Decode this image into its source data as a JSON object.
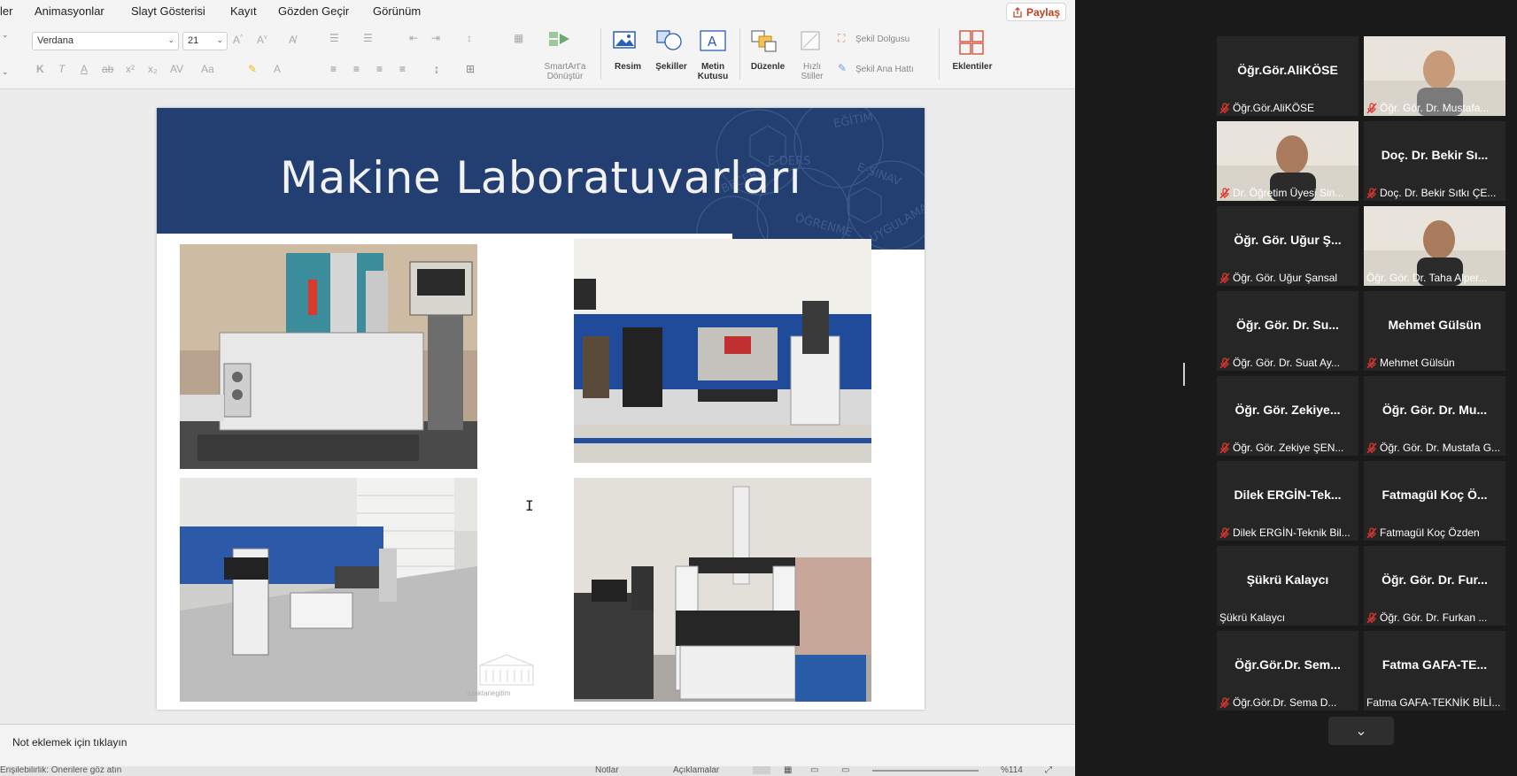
{
  "menu": {
    "items": [
      "ler",
      "Animasyonlar",
      "Slayt Gösterisi",
      "Kayıt",
      "Gözden Geçir",
      "Görünüm"
    ],
    "share_label": "Paylaş"
  },
  "ribbon": {
    "font_name": "Verdana",
    "font_size": "21",
    "smartart_label": "SmartArt'a\nDönüştür",
    "picture_label": "Resim",
    "shapes_label": "Şekiller",
    "textbox_label": "Metin\nKutusu",
    "arrange_label": "Düzenle",
    "quickstyles_label": "Hızlı\nStiller",
    "shape_fill_label": "Şekil Dolgusu",
    "shape_outline_label": "Şekil Ana Hattı",
    "addins_label": "Eklentiler"
  },
  "slide": {
    "title": "Makine Laboratuvarları",
    "banner_words": [
      "E-DERS",
      "EĞİTİM",
      "E-SINAV",
      "BECERİ",
      "ÖĞRENME",
      "UYGULAMA"
    ],
    "watermark_text": "uzaktanegitim"
  },
  "notes": {
    "placeholder": "Not eklemek için tıklayın"
  },
  "status": {
    "left": "Erişilebilirlik: Önerilere göz atın",
    "notes_label": "Notlar",
    "comments_label": "Açıklamalar",
    "zoom": "%114"
  },
  "participants": [
    {
      "big": "Öğr.Gör.AliKÖSE",
      "name": "Öğr.Gör.AliKÖSE",
      "muted": true,
      "video": false
    },
    {
      "big": "",
      "name": "Öğr. Gör. Dr. Mustafa...",
      "muted": true,
      "video": true
    },
    {
      "big": "",
      "name": "Dr. Öğretim Üyesi Sin...",
      "muted": true,
      "video": true
    },
    {
      "big": "Doç. Dr. Bekir Sı...",
      "name": "Doç. Dr. Bekir Sıtkı ÇE...",
      "muted": true,
      "video": false
    },
    {
      "big": "Öğr. Gör. Uğur Ş...",
      "name": "Öğr. Gör. Uğur Şansal",
      "muted": true,
      "video": false
    },
    {
      "big": "",
      "name": "Öğr. Gör. Dr. Taha Alper...",
      "muted": false,
      "video": true,
      "active": true
    },
    {
      "big": "Öğr. Gör. Dr. Su...",
      "name": "Öğr. Gör. Dr. Suat Ay...",
      "muted": true,
      "video": false
    },
    {
      "big": "Mehmet Gülsün",
      "name": "Mehmet Gülsün",
      "muted": true,
      "video": false
    },
    {
      "big": "Öğr. Gör. Zekiye...",
      "name": "Öğr. Gör. Zekiye ŞEN...",
      "muted": true,
      "video": false
    },
    {
      "big": "Öğr. Gör. Dr. Mu...",
      "name": "Öğr. Gör. Dr. Mustafa G...",
      "muted": true,
      "video": false
    },
    {
      "big": "Dilek ERGİN-Tek...",
      "name": "Dilek ERGİN-Teknik Bil...",
      "muted": true,
      "video": false
    },
    {
      "big": "Fatmagül Koç Ö...",
      "name": "Fatmagül Koç Özden",
      "muted": true,
      "video": false
    },
    {
      "big": "Şükrü Kalaycı",
      "name": "Şükrü Kalaycı",
      "muted": false,
      "video": false
    },
    {
      "big": "Öğr. Gör. Dr. Fur...",
      "name": "Öğr. Gör. Dr. Furkan ...",
      "muted": true,
      "video": false
    },
    {
      "big": "Öğr.Gör.Dr. Sem...",
      "name": "Öğr.Gör.Dr. Sema D...",
      "muted": true,
      "video": false
    },
    {
      "big": "Fatma GAFA-TE...",
      "name": "Fatma GAFA-TEKNİK BİLİ...",
      "muted": false,
      "video": false
    }
  ],
  "colors": {
    "banner": "#233e70",
    "active_speaker": "#b5d13a",
    "mute_red": "#e0362f",
    "share_red": "#c43e1c"
  }
}
